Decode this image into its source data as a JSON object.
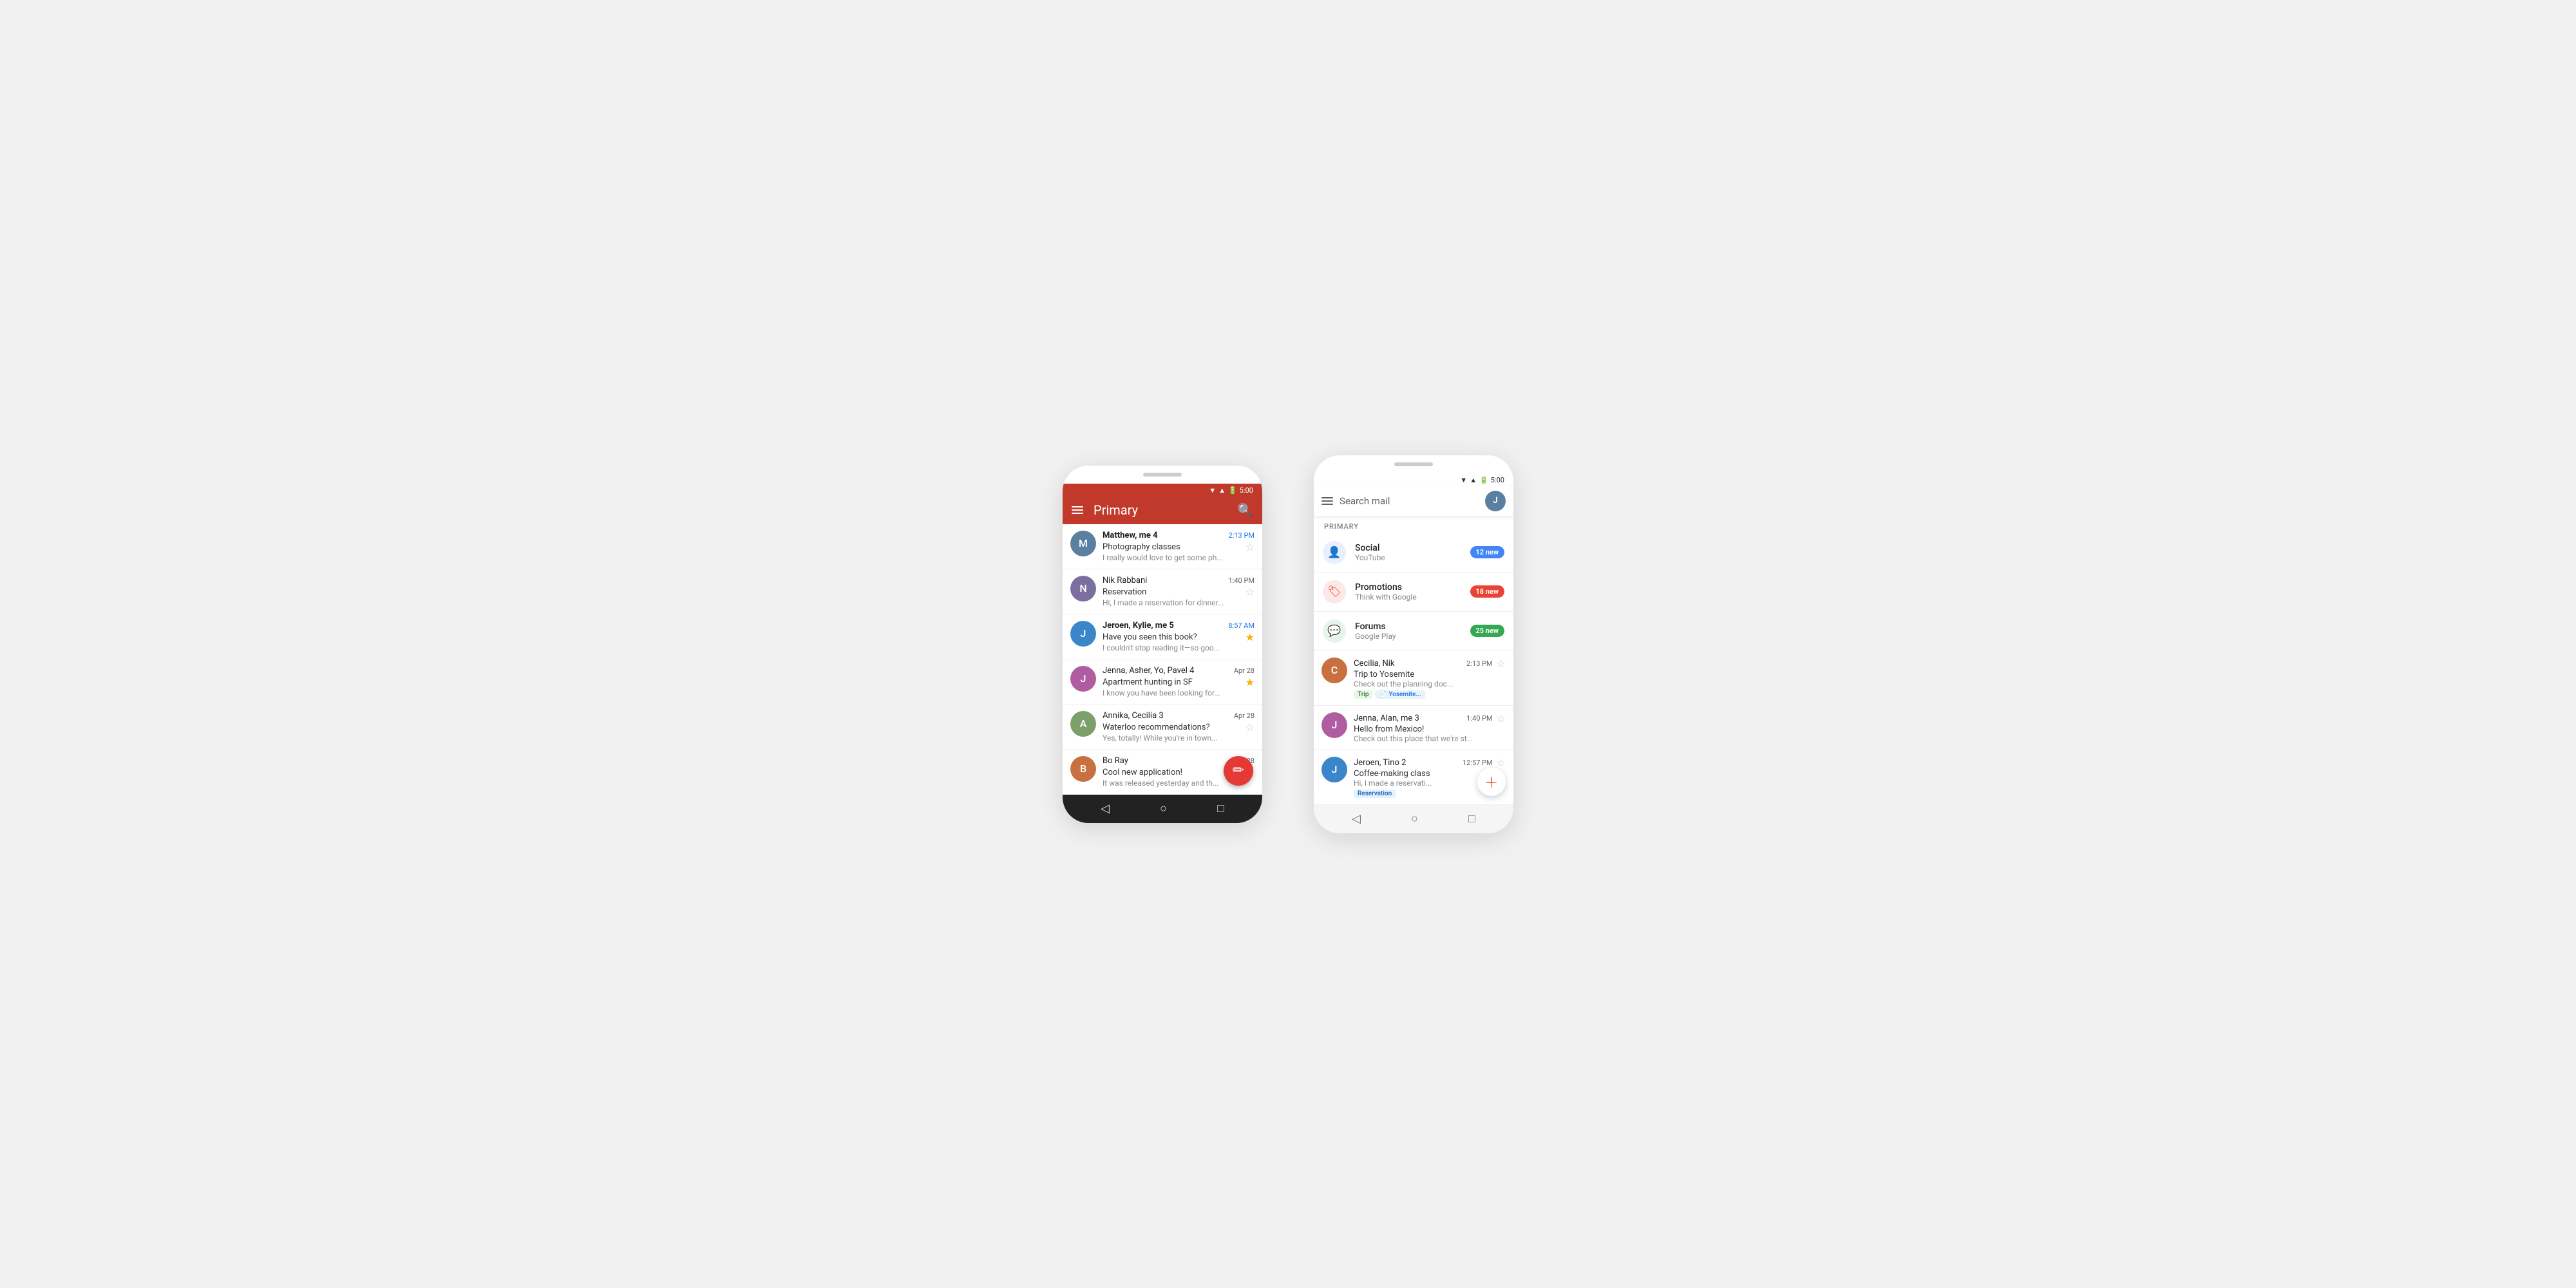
{
  "phone1": {
    "status_time": "5:00",
    "header_title": "Primary",
    "emails": [
      {
        "sender": "Matthew, me",
        "count": "4",
        "time": "2:13 PM",
        "subject": "Photography classes",
        "preview": "I really would love to get some ph...",
        "starred": false,
        "unread": true,
        "avatar_color": "#5b7fa1",
        "avatar_initials": "M"
      },
      {
        "sender": "Nik Rabbani",
        "count": "",
        "time": "1:40 PM",
        "subject": "Reservation",
        "preview": "Hi, I made a reservation for dinner...",
        "starred": false,
        "unread": false,
        "avatar_color": "#7b6fa0",
        "avatar_initials": "N"
      },
      {
        "sender": "Jeroen, Kylie, me",
        "count": "5",
        "time": "8:57 AM",
        "subject": "Have you seen this book?",
        "preview": "I couldn't stop reading it—so goo...",
        "starred": true,
        "unread": true,
        "avatar_color": "#3a86c8",
        "avatar_initials": "J"
      },
      {
        "sender": "Jenna, Asher, Yo, Pavel",
        "count": "4",
        "time": "Apr 28",
        "subject": "Apartment hunting in SF",
        "preview": "I know you have been looking for...",
        "starred": true,
        "unread": false,
        "avatar_color": "#b05ca0",
        "avatar_initials": "J"
      },
      {
        "sender": "Annika, Cecilia",
        "count": "3",
        "time": "Apr 28",
        "subject": "Waterloo recommendations?",
        "preview": "Yes, totally! While you're in town...",
        "starred": false,
        "unread": false,
        "avatar_color": "#7ca06a",
        "avatar_initials": "A"
      },
      {
        "sender": "Bo Ray",
        "count": "",
        "time": "Apr 28",
        "subject": "Cool new application!",
        "preview": "It was released yesterday and th...",
        "starred": false,
        "unread": false,
        "avatar_color": "#c97040",
        "avatar_initials": "B"
      }
    ],
    "fab_icon": "✏"
  },
  "phone2": {
    "status_time": "5:00",
    "search_placeholder": "Search mail",
    "section_label": "PRIMARY",
    "categories": [
      {
        "name": "Social",
        "sub": "YouTube",
        "badge_text": "12 new",
        "badge_color": "blue",
        "icon": "👤",
        "icon_class": "social"
      },
      {
        "name": "Promotions",
        "sub": "Think with Google",
        "badge_text": "18 new",
        "badge_color": "red",
        "icon": "🏷",
        "icon_class": "promo"
      },
      {
        "name": "Forums",
        "sub": "Google Play",
        "badge_text": "25 new",
        "badge_color": "green",
        "icon": "💬",
        "icon_class": "forum"
      }
    ],
    "emails": [
      {
        "sender": "Cecilia, Nik",
        "count": "",
        "time": "2:13 PM",
        "subject": "Trip to Yosemite",
        "preview": "Check out the planning doc...",
        "starred": false,
        "tag": "trip",
        "tag_label": "Trip",
        "tag2": "yosemite",
        "tag2_label": "📄 Yosemite...",
        "avatar_color": "#c97040",
        "avatar_initials": "C"
      },
      {
        "sender": "Jenna, Alan, me",
        "count": "3",
        "time": "1:40 PM",
        "subject": "Hello from Mexico!",
        "preview": "Check out this place that we're st...",
        "starred": false,
        "avatar_color": "#b05ca0",
        "avatar_initials": "J"
      },
      {
        "sender": "Jeroen, Tino",
        "count": "2",
        "time": "12:57 PM",
        "subject": "Coffee-making class",
        "preview": "Hi, I made a reservati...",
        "starred": false,
        "tag": "reservation",
        "tag_label": "Reservation",
        "avatar_color": "#3a86c8",
        "avatar_initials": "J"
      }
    ]
  }
}
